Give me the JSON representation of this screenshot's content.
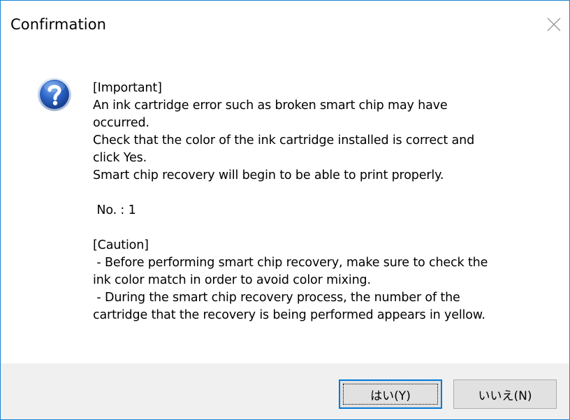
{
  "window": {
    "title": "Confirmation",
    "close_label": "×"
  },
  "icon": "question-icon",
  "message": {
    "lines": [
      "[Important]",
      "An ink cartridge error such as broken smart chip may have",
      "occurred.",
      "Check that the color of the ink cartridge installed is correct and",
      "click Yes.",
      "Smart chip recovery will begin to be able to print properly.",
      "",
      " No. : 1",
      "",
      "[Caution]",
      " - Before performing smart chip recovery, make sure to check the",
      "ink color match in order to avoid color mixing.",
      " - During the smart chip recovery process, the number of the",
      "cartridge that the recovery is being performed appears in yellow."
    ]
  },
  "buttons": {
    "yes_label": "はい(Y)",
    "no_label": "いいえ(N)"
  },
  "colors": {
    "window_border": "#1883d7",
    "footer_bg": "#f0f0f0",
    "default_button_border": "#0078d7",
    "icon_blue": "#1f5fb8"
  }
}
